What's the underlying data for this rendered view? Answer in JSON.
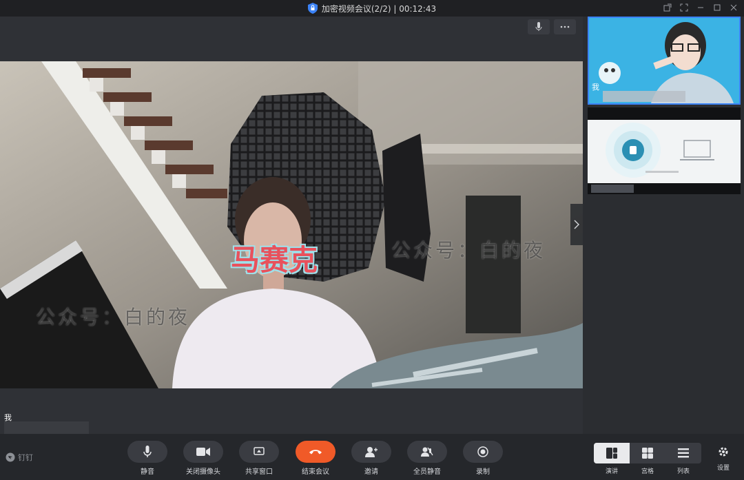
{
  "window": {
    "title": "加密视频会议(2/2) | 00:12:43",
    "controls": [
      "popout-icon",
      "fullscreen-icon",
      "minimize-icon",
      "maximize-icon",
      "close-icon"
    ]
  },
  "stage": {
    "caption": "马赛克",
    "watermark_1": "公众号：白的夜",
    "watermark_2": "公众号：白的夜",
    "speaker_name": "我"
  },
  "side_panel": {
    "thumb1_name": "我"
  },
  "brand": {
    "label": "钉钉"
  },
  "toolbar": {
    "mute": "静音",
    "camera_off": "关闭摄像头",
    "share": "共享窗口",
    "end": "结束会议",
    "invite": "邀请",
    "mute_all": "全员静音",
    "record": "录制",
    "view_speaker": "演讲",
    "view_grid": "宫格",
    "view_list": "列表",
    "settings": "设置"
  },
  "colors": {
    "end_button": "#f05a28",
    "accent": "#3b82f6"
  }
}
